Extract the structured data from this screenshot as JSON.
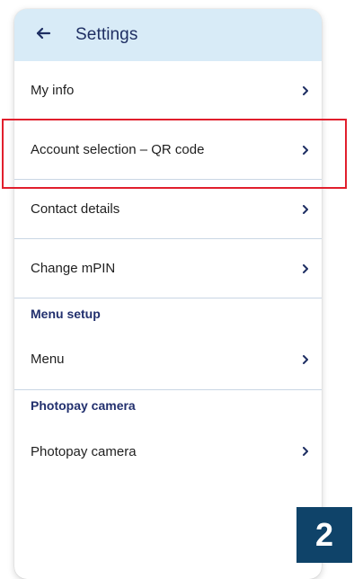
{
  "header": {
    "title": "Settings",
    "back_icon": "arrow-left-icon"
  },
  "items": [
    {
      "label": "My info"
    },
    {
      "label": "Account selection – QR code"
    },
    {
      "label": "Contact details"
    },
    {
      "label": "Change mPIN"
    }
  ],
  "sections": [
    {
      "heading": "Menu setup",
      "items": [
        {
          "label": "Menu"
        }
      ]
    },
    {
      "heading": "Photopay camera",
      "items": [
        {
          "label": "Photopay camera"
        }
      ]
    }
  ],
  "highlight": {
    "color": "#e11f2d"
  },
  "step_badge": {
    "value": "2"
  },
  "colors": {
    "header_bg": "#d8ebf7",
    "title": "#1f2f63",
    "divider": "#c9d6e4",
    "section_heading": "#22306e",
    "badge_bg": "#0f4369"
  }
}
